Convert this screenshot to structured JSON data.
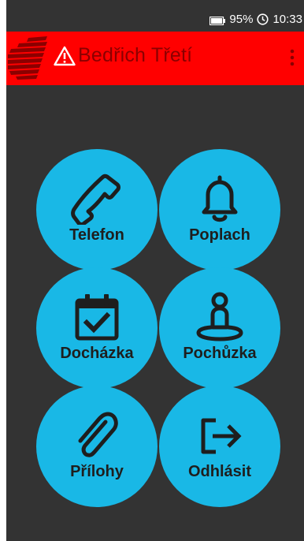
{
  "status_bar": {
    "battery": "95%",
    "time": "10:33",
    "battery_icon": "battery-icon",
    "clock_icon": "clock-icon"
  },
  "app_bar": {
    "title": "Bedřich Třetí",
    "title_color": "#8b0000",
    "background": "#ff0000",
    "warning_icon": "warning-triangle-icon",
    "menu_icon": "more-vert-icon"
  },
  "tiles": [
    {
      "label": "Telefon",
      "icon": "phone-icon"
    },
    {
      "label": "Poplach",
      "icon": "bell-icon"
    },
    {
      "label": "Docházka",
      "icon": "calendar-check-icon"
    },
    {
      "label": "Pochůzka",
      "icon": "person-location-icon"
    },
    {
      "label": "Přílohy",
      "icon": "paperclip-icon"
    },
    {
      "label": "Odhlásit",
      "icon": "logout-icon"
    }
  ],
  "colors": {
    "background": "#333333",
    "tile": "#19b8e6",
    "tile_text": "#1e1e1e"
  }
}
